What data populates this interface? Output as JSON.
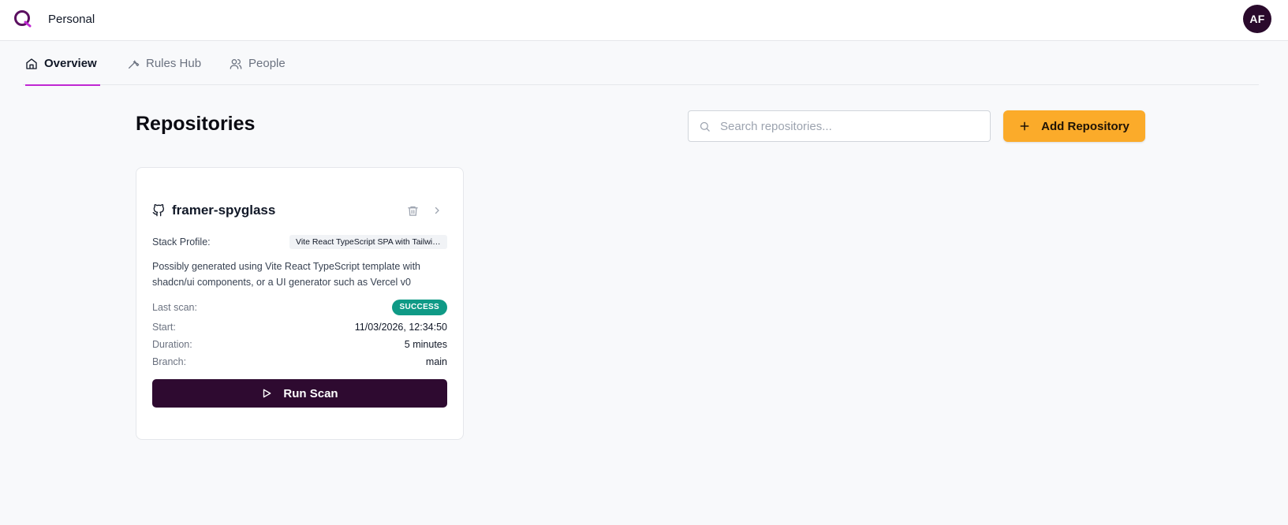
{
  "header": {
    "logo_icon": "app-logo-icon",
    "workspace": "Personal",
    "avatar_initials": "AF"
  },
  "tabs": [
    {
      "label": "Overview",
      "icon": "home-icon",
      "active": true
    },
    {
      "label": "Rules Hub",
      "icon": "wrench-icon",
      "active": false
    },
    {
      "label": "People",
      "icon": "users-icon",
      "active": false
    }
  ],
  "main": {
    "title": "Repositories",
    "search": {
      "placeholder": "Search repositories...",
      "value": ""
    },
    "add_button": "Add Repository"
  },
  "repos": [
    {
      "name": "framer-spyglass",
      "stack_profile_label": "Stack Profile:",
      "stack_profile": "Vite React TypeScript SPA with Tailwind CSS and shadcn/ui",
      "description": "Possibly generated using Vite React TypeScript template with shadcn/ui components, or a UI generator such as Vercel v0",
      "last_scan_label": "Last scan:",
      "last_scan_status": "SUCCESS",
      "start_label": "Start:",
      "start": "11/03/2026, 12:34:50",
      "duration_label": "Duration:",
      "duration": "5 minutes",
      "branch_label": "Branch:",
      "branch": "main",
      "run_button": "Run Scan"
    }
  ],
  "colors": {
    "accent": "#c026d3",
    "primary_dark": "#2e0a30",
    "add_button": "#fbab2a",
    "success": "#0f9a86"
  }
}
